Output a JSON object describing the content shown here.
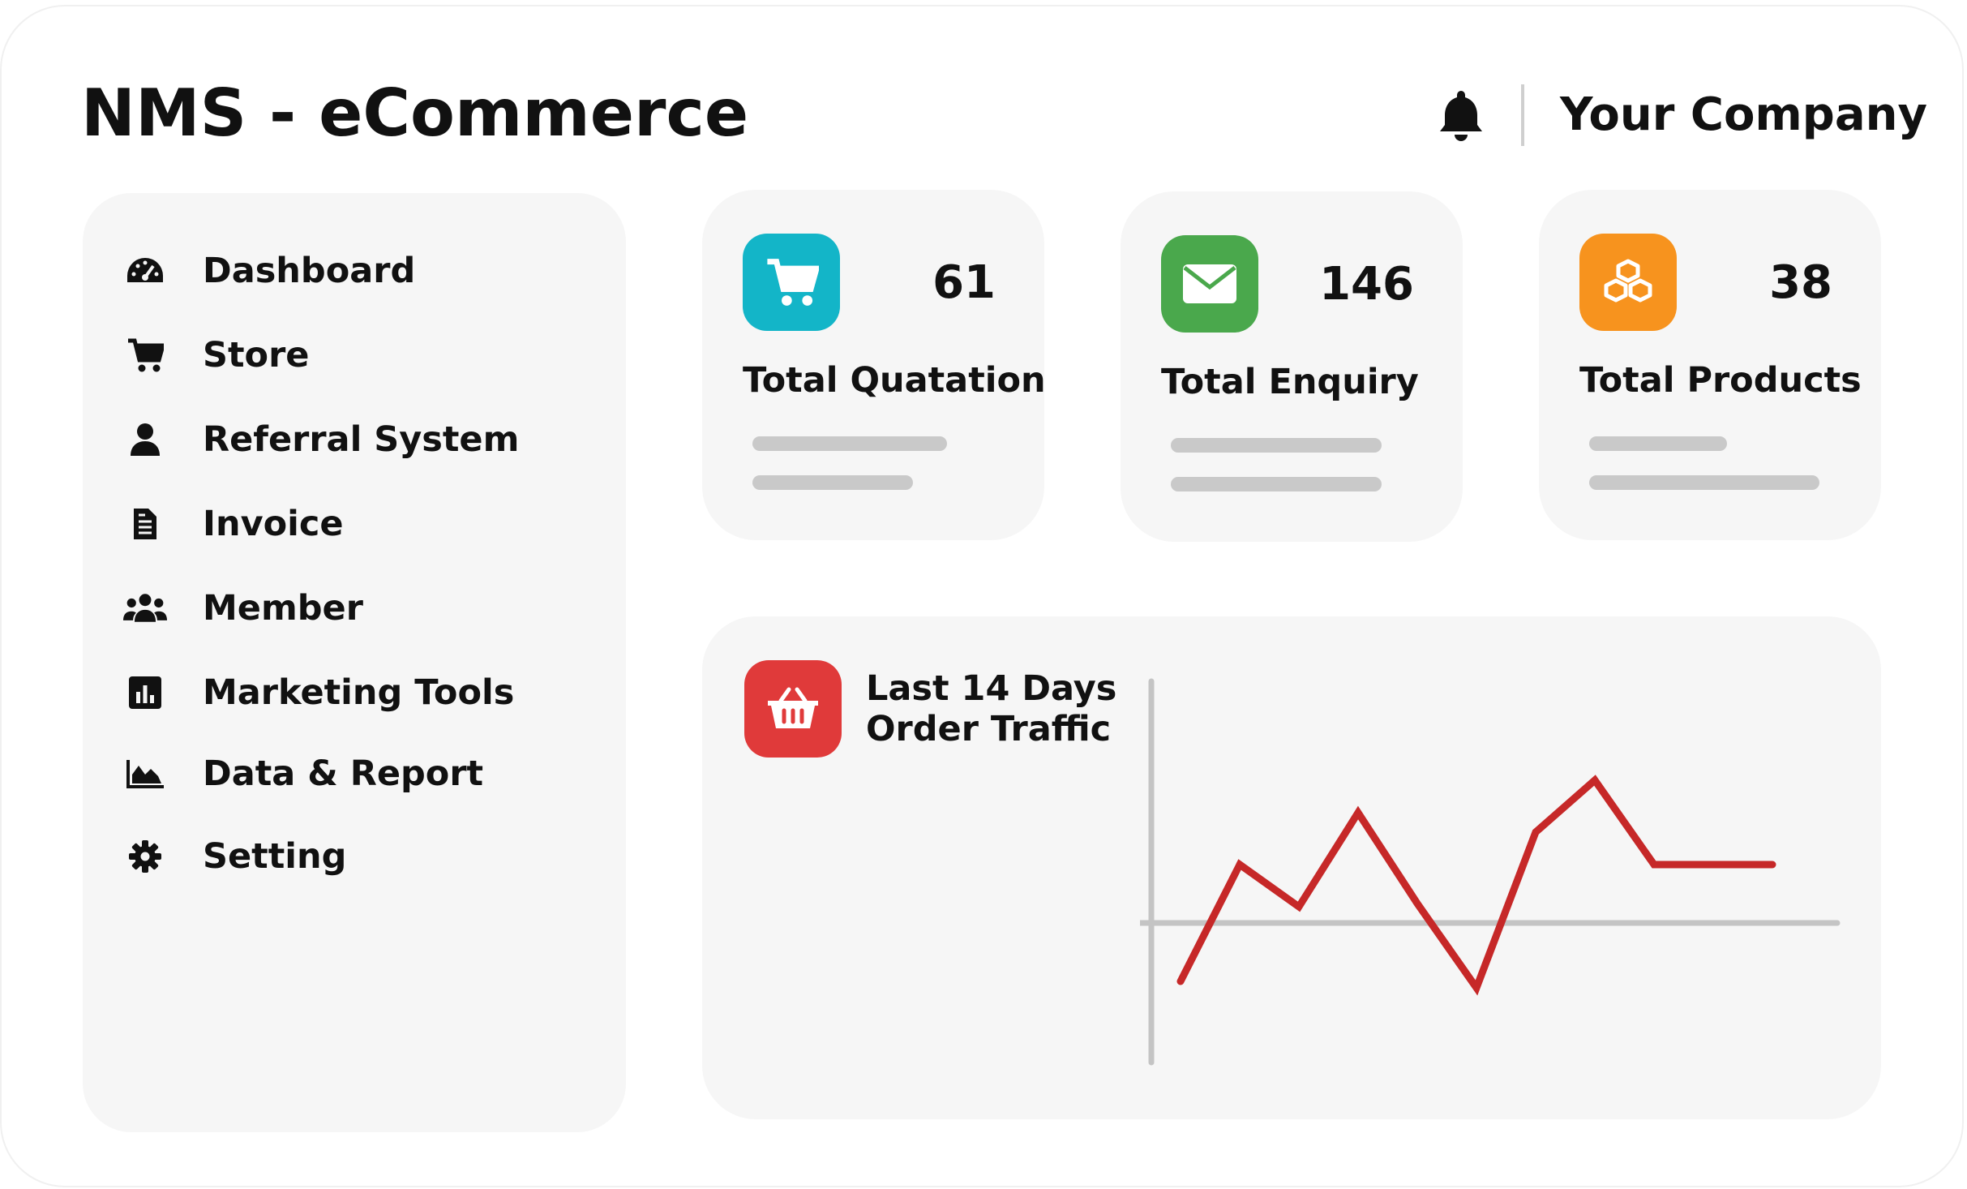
{
  "header": {
    "title": "NMS - eCommerce",
    "company": "Your Company",
    "bell_icon": "bell-icon"
  },
  "sidebar": {
    "items": [
      {
        "label": "Dashboard",
        "icon": "dashboard-gauge-icon"
      },
      {
        "label": "Store",
        "icon": "cart-icon"
      },
      {
        "label": "Referral System",
        "icon": "user-icon"
      },
      {
        "label": "Invoice",
        "icon": "document-icon"
      },
      {
        "label": "Member",
        "icon": "users-icon"
      },
      {
        "label": "Marketing Tools",
        "icon": "bar-chart-icon"
      },
      {
        "label": "Data & Report",
        "icon": "area-chart-icon"
      },
      {
        "label": "Setting",
        "icon": "gear-icon"
      }
    ]
  },
  "cards": [
    {
      "value": "61",
      "label": "Total Quatation",
      "icon": "cart-icon",
      "color": "#13b5c8"
    },
    {
      "value": "146",
      "label": "Total Enquiry",
      "icon": "envelope-icon",
      "color": "#4aa84c"
    },
    {
      "value": "38",
      "label": "Total Products",
      "icon": "boxes-icon",
      "color": "#f7931e"
    }
  ],
  "traffic": {
    "title_line1": "Last 14 Days",
    "title_line2": "Order Traffic",
    "icon": "basket-icon",
    "color": "#e03a3a"
  },
  "chart_data": {
    "type": "line",
    "x": [
      1,
      2,
      3,
      4,
      5,
      6,
      7,
      8,
      9,
      10,
      11
    ],
    "values": [
      -0.9,
      0.9,
      0.25,
      1.7,
      0.3,
      -1.0,
      1.4,
      2.2,
      0.9,
      0.9,
      0.9
    ],
    "line_color": "#c62828",
    "grid": false
  }
}
